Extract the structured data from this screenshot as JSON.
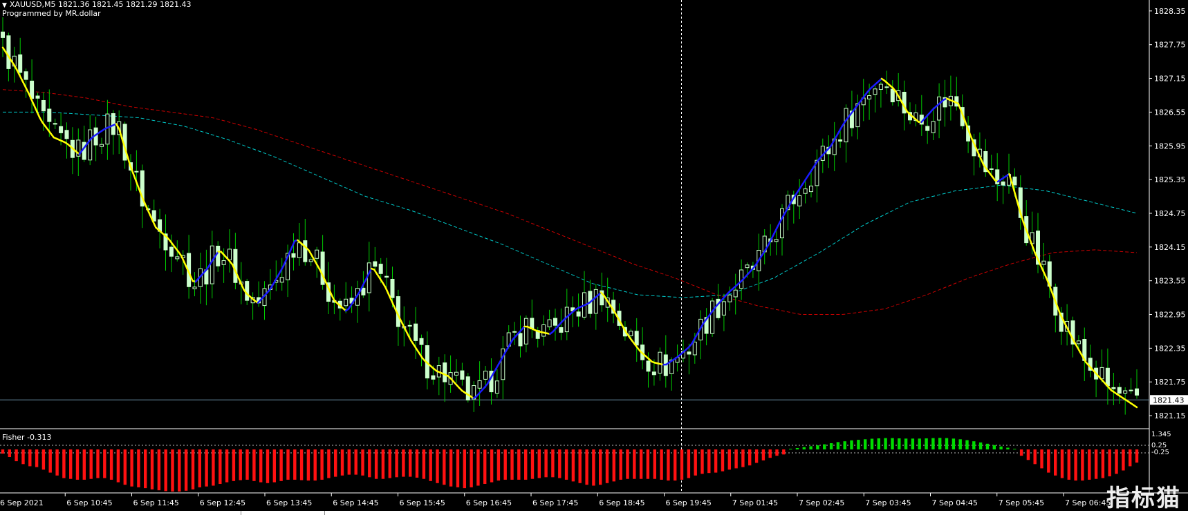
{
  "header": {
    "symbol_line": "XAUUSD,M5  1821.36 1821.45 1821.29 1821.43",
    "credit": "Programmed by MR.dollar"
  },
  "fisher": {
    "label": "Fisher -0.313"
  },
  "watermark": "指标猫",
  "colors": {
    "background": "#000000",
    "bull_candle": "#ccffcc",
    "bear_candle": "#ccffcc",
    "wick": "#00cc00",
    "signal_up": "#1a1aff",
    "signal_down": "#ffff00",
    "ma_red": "#cc0000",
    "ma_cyan": "#00cccc",
    "hist_pos": "#00dd00",
    "hist_neg": "#ff1111",
    "price_line": "#6c8fa8"
  },
  "chart_data": [
    {
      "type": "candlestick",
      "symbol": "XAUUSD",
      "timeframe": "M5",
      "price_axis_ticks": [
        "1828.35",
        "1827.75",
        "1827.15",
        "1826.55",
        "1825.95",
        "1825.35",
        "1824.75",
        "1824.15",
        "1823.55",
        "1822.95",
        "1822.35",
        "1821.75",
        "1821.15"
      ],
      "current_price_label": "1821.43",
      "current_price": 1821.43,
      "ylim": [
        1820.93,
        1828.52
      ],
      "time_axis_labels": [
        "6 Sep 2021",
        "6 Sep 10:45",
        "6 Sep 11:45",
        "6 Sep 12:45",
        "6 Sep 13:45",
        "6 Sep 14:45",
        "6 Sep 15:45",
        "6 Sep 16:45",
        "6 Sep 17:45",
        "6 Sep 18:45",
        "6 Sep 19:45",
        "7 Sep 01:45",
        "7 Sep 02:45",
        "7 Sep 03:45",
        "7 Sep 04:45",
        "7 Sep 05:45",
        "7 Sep 06:45"
      ],
      "crosshair_after_label": "6 Sep 19:45",
      "close_path": [
        1827.7,
        1827.35,
        1826.9,
        1826.4,
        1826.1,
        1826.0,
        1825.8,
        1826.1,
        1826.25,
        1826.35,
        1825.6,
        1825.0,
        1824.5,
        1824.3,
        1824.0,
        1823.5,
        1823.75,
        1824.1,
        1823.85,
        1823.35,
        1823.15,
        1823.4,
        1823.8,
        1824.3,
        1824.1,
        1823.7,
        1823.2,
        1823.0,
        1823.35,
        1823.8,
        1823.45,
        1822.95,
        1822.5,
        1822.15,
        1821.95,
        1821.85,
        1821.6,
        1821.45,
        1821.7,
        1822.1,
        1822.5,
        1822.75,
        1822.65,
        1822.6,
        1822.85,
        1823.05,
        1823.15,
        1823.35,
        1823.0,
        1822.6,
        1822.3,
        1822.1,
        1822.05,
        1822.2,
        1822.4,
        1822.8,
        1823.1,
        1823.35,
        1823.55,
        1823.8,
        1824.15,
        1824.6,
        1825.0,
        1825.35,
        1825.7,
        1825.95,
        1826.35,
        1826.65,
        1826.95,
        1827.15,
        1826.95,
        1826.55,
        1826.35,
        1826.6,
        1826.8,
        1826.7,
        1826.1,
        1825.6,
        1825.3,
        1825.45,
        1824.65,
        1824.05,
        1823.55,
        1822.95,
        1822.5,
        1822.1,
        1821.85,
        1821.6,
        1821.45,
        1821.3
      ]
    },
    {
      "type": "line",
      "role": "moving-averages",
      "series": [
        {
          "values": [
            1826.55,
            1826.55,
            1826.5,
            1826.45,
            1826.3,
            1826.05,
            1825.75,
            1825.4,
            1825.05,
            1824.8,
            1824.5,
            1824.2,
            1823.85,
            1823.5,
            1823.3,
            1823.25,
            1823.3,
            1823.6,
            1824.05,
            1824.55,
            1824.95,
            1825.15,
            1825.25,
            1825.15,
            1824.95,
            1824.75
          ]
        },
        {
          "values": [
            1826.95,
            1826.9,
            1826.8,
            1826.65,
            1826.55,
            1826.45,
            1826.25,
            1826.0,
            1825.75,
            1825.5,
            1825.25,
            1825.0,
            1824.75,
            1824.45,
            1824.15,
            1823.85,
            1823.6,
            1823.3,
            1823.1,
            1822.95,
            1822.95,
            1823.05,
            1823.3,
            1823.6,
            1823.85,
            1824.05,
            1824.1,
            1824.05
          ]
        }
      ]
    },
    {
      "type": "bar",
      "title": "Fisher -0.313",
      "axis_ticks": [
        "1.345",
        "0.25",
        "-0.25"
      ],
      "ylim": [
        -0.6,
        1.345
      ],
      "values": [
        -0.1,
        -0.18,
        -0.28,
        -0.35,
        -0.4,
        -0.42,
        -0.48,
        -0.55,
        -0.62,
        -0.68,
        -0.7,
        -0.72,
        -0.72,
        -0.7,
        -0.68,
        -0.68,
        -0.72,
        -0.78,
        -0.84,
        -0.88,
        -0.9,
        -0.92,
        -0.95,
        -0.97,
        -0.99,
        -1.0,
        -1.0,
        -0.98,
        -0.95,
        -0.9,
        -0.88,
        -0.86,
        -0.82,
        -0.78,
        -0.75,
        -0.73,
        -0.72,
        -0.75,
        -0.78,
        -0.8,
        -0.78,
        -0.75,
        -0.72,
        -0.72,
        -0.73,
        -0.74,
        -0.74,
        -0.72,
        -0.68,
        -0.65,
        -0.62,
        -0.6,
        -0.6,
        -0.62,
        -0.66,
        -0.7,
        -0.7,
        -0.68,
        -0.66,
        -0.65,
        -0.65,
        -0.67,
        -0.7,
        -0.75,
        -0.8,
        -0.84,
        -0.88,
        -0.9,
        -0.92,
        -0.9,
        -0.86,
        -0.82,
        -0.78,
        -0.74,
        -0.72,
        -0.72,
        -0.72,
        -0.72,
        -0.7,
        -0.68,
        -0.66,
        -0.66,
        -0.68,
        -0.72,
        -0.76,
        -0.8,
        -0.84,
        -0.86,
        -0.84,
        -0.8,
        -0.76,
        -0.72,
        -0.7,
        -0.7,
        -0.7,
        -0.7,
        -0.7,
        -0.72,
        -0.74,
        -0.74,
        -0.72,
        -0.68,
        -0.62,
        -0.58,
        -0.56,
        -0.55,
        -0.52,
        -0.48,
        -0.45,
        -0.42,
        -0.38,
        -0.32,
        -0.26,
        -0.2,
        -0.15,
        -0.12,
        0.06,
        0.12,
        0.2,
        0.28,
        0.36,
        0.45,
        0.55,
        0.65,
        0.72,
        0.8,
        0.85,
        0.9,
        0.95,
        0.98,
        1.0,
        1.0,
        0.98,
        0.96,
        0.96,
        0.96,
        0.98,
        1.0,
        1.02,
        1.0,
        0.96,
        0.9,
        0.82,
        0.72,
        0.62,
        0.5,
        0.38,
        0.26,
        0.15,
        0.06,
        -0.15,
        -0.25,
        -0.35,
        -0.45,
        -0.55,
        -0.62,
        -0.68,
        -0.72,
        -0.74,
        -0.74,
        -0.72,
        -0.7,
        -0.68,
        -0.64,
        -0.58,
        -0.5,
        -0.4,
        -0.313
      ]
    }
  ]
}
